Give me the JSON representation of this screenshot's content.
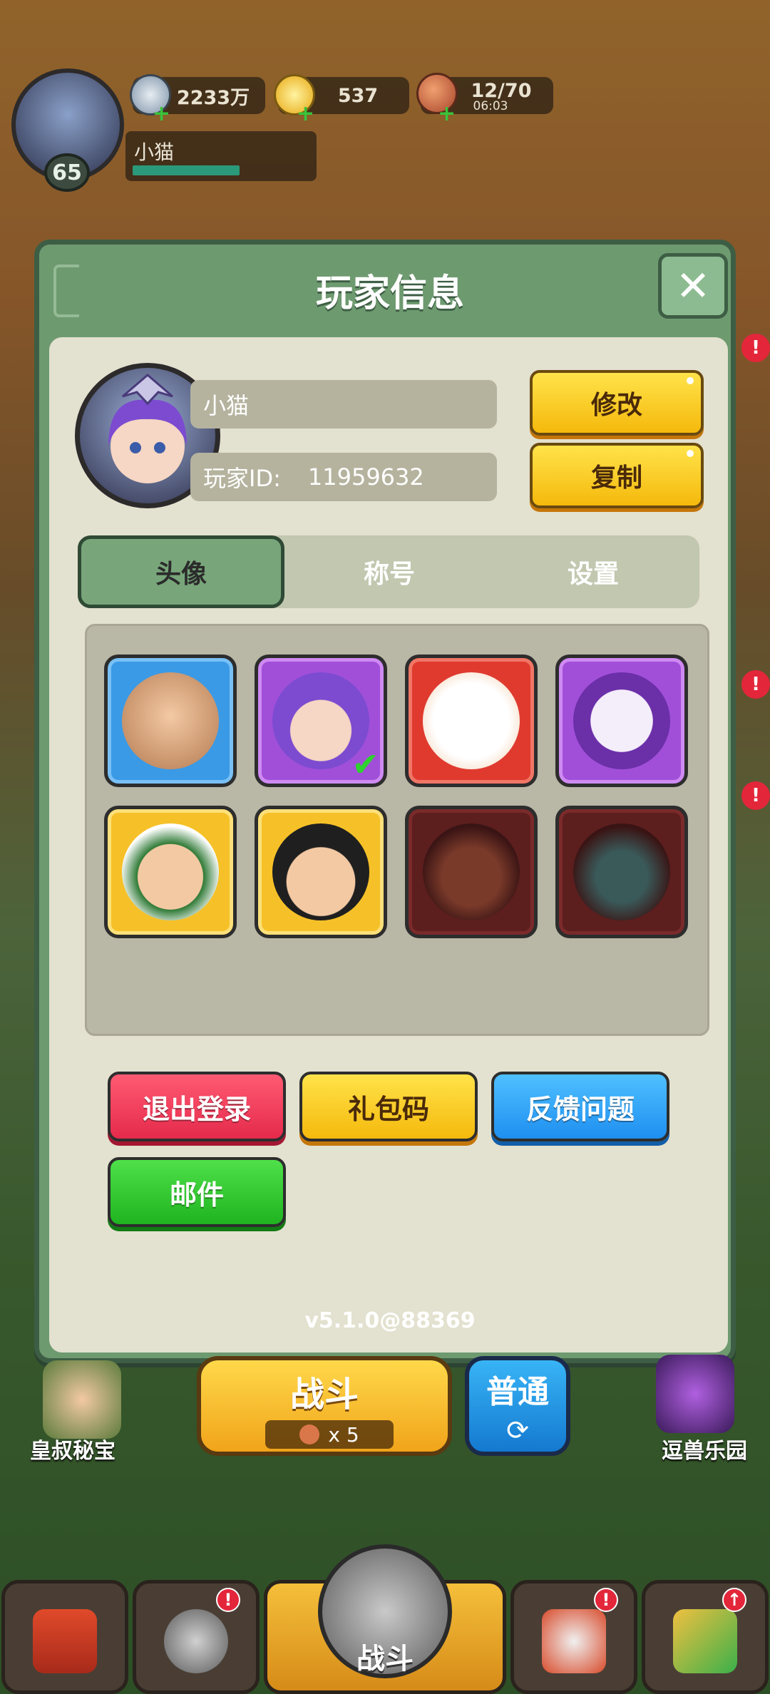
{
  "hud": {
    "level": "65",
    "name": "小猫",
    "coins": "2233万",
    "gold": "537",
    "stamina": "12/70",
    "stamina_timer": "06:03",
    "plus": "+"
  },
  "modal": {
    "title": "玩家信息",
    "close_label": "✕",
    "player_name": "小猫",
    "player_id_label": "玩家ID:",
    "player_id": "11959632",
    "edit_button": "修改",
    "copy_button": "复制",
    "tabs": [
      {
        "label": "头像",
        "active": true
      },
      {
        "label": "称号",
        "active": false
      },
      {
        "label": "设置",
        "active": false
      }
    ],
    "avatars": [
      {
        "name": "warrior-blue",
        "color": "blue",
        "owned": true,
        "selected": false
      },
      {
        "name": "purple-hair-girl",
        "color": "purple",
        "owned": true,
        "selected": true
      },
      {
        "name": "lucky-cat",
        "color": "red",
        "owned": true,
        "selected": false
      },
      {
        "name": "unicorn",
        "color": "purple",
        "owned": true,
        "selected": false
      },
      {
        "name": "green-headband-hero",
        "color": "gold",
        "owned": true,
        "selected": false
      },
      {
        "name": "sunglasses-man",
        "color": "gold",
        "owned": true,
        "selected": false
      },
      {
        "name": "demon-warrior",
        "color": "dark",
        "owned": false,
        "selected": false
      },
      {
        "name": "dragon",
        "color": "dark",
        "owned": false,
        "selected": false
      }
    ],
    "selected_check": "✔",
    "actions": {
      "logout": "退出登录",
      "gift_code": "礼包码",
      "feedback": "反馈问题",
      "mail": "邮件"
    },
    "version": "v5.1.0@88369"
  },
  "bottom": {
    "battle_label": "战斗",
    "battle_cost": "x 5",
    "mode_label": "普通",
    "mode_icon": "⟳",
    "left_feature": "皇叔秘宝",
    "right_feature": "逗兽乐园",
    "nav_center_label": "战斗",
    "badge_mark": "!",
    "badge_up": "↑"
  },
  "colors": {
    "modal_bg": "#6e9a70",
    "panel_bg": "#e3e1cf",
    "accent_yellow": "#f5b90c",
    "logout_red": "#e52a4c",
    "feedback_blue": "#1e8ff0",
    "mail_green": "#1fb420"
  }
}
